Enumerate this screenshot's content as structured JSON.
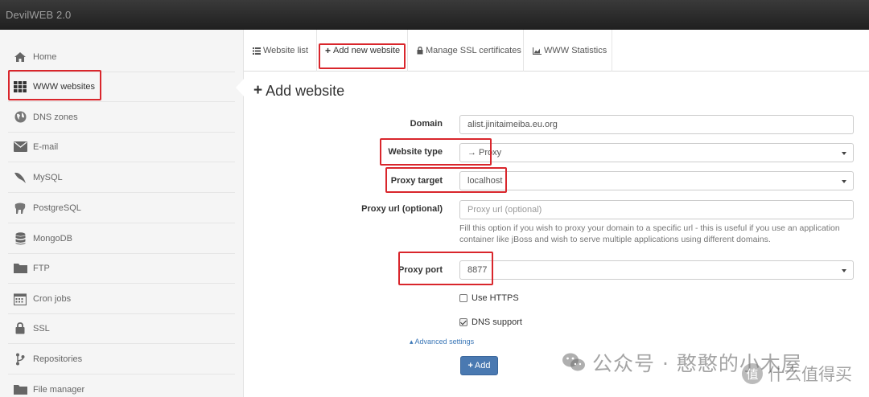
{
  "app": {
    "title": "DevilWEB 2.0"
  },
  "sidebar": {
    "items": [
      {
        "label": "Home",
        "icon": "home-icon"
      },
      {
        "label": "WWW websites",
        "icon": "grid-icon"
      },
      {
        "label": "DNS zones",
        "icon": "globe-icon"
      },
      {
        "label": "E-mail",
        "icon": "envelope-icon"
      },
      {
        "label": "MySQL",
        "icon": "dolphin-icon"
      },
      {
        "label": "PostgreSQL",
        "icon": "elephant-icon"
      },
      {
        "label": "MongoDB",
        "icon": "database-icon"
      },
      {
        "label": "FTP",
        "icon": "folder-icon"
      },
      {
        "label": "Cron jobs",
        "icon": "calendar-icon"
      },
      {
        "label": "SSL",
        "icon": "lock-icon"
      },
      {
        "label": "Repositories",
        "icon": "branch-icon"
      },
      {
        "label": "File manager",
        "icon": "folder-icon"
      }
    ]
  },
  "tabs": [
    {
      "label": "Website list",
      "icon": "list-icon"
    },
    {
      "label": "Add new website",
      "icon": "plus-icon"
    },
    {
      "label": "Manage SSL certificates",
      "icon": "lock-icon"
    },
    {
      "label": "WWW Statistics",
      "icon": "chart-icon"
    }
  ],
  "main": {
    "title": "Add website",
    "form": {
      "domain_label": "Domain",
      "domain_value": "alist.jinitaimeiba.eu.org",
      "website_type_label": "Website type",
      "website_type_value": "Proxy",
      "proxy_target_label": "Proxy target",
      "proxy_target_value": "localhost",
      "proxy_url_label": "Proxy url (optional)",
      "proxy_url_placeholder": "Proxy url (optional)",
      "proxy_url_help": "Fill this option if you wish to proxy your domain to a specific url - this is useful if you use an application container like jBoss and wish to serve multiple applications using different domains.",
      "proxy_port_label": "Proxy port",
      "proxy_port_value": "8877",
      "use_https_label": "Use HTTPS",
      "use_https_checked": false,
      "dns_support_label": "DNS support",
      "dns_support_checked": true,
      "advanced_label": "Advanced settings",
      "add_button_label": "Add"
    }
  },
  "watermark": {
    "text": "公众号 · 憨憨的小木屋",
    "text2": "什么值得买",
    "icon2": "值"
  },
  "colors": {
    "highlight": "#d9262c",
    "primary_button": "#4a79b1",
    "link": "#3b77b7"
  }
}
